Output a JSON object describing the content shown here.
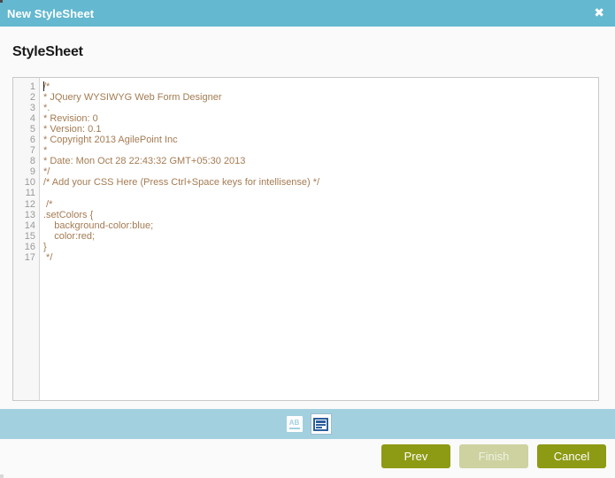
{
  "window": {
    "title": "New StyleSheet",
    "close_icon": "close-icon",
    "close_glyph": "✖"
  },
  "heading": {
    "text": "StyleSheet"
  },
  "editor": {
    "line_numbers": [
      "1",
      "2",
      "3",
      "4",
      "5",
      "6",
      "7",
      "8",
      "9",
      "10",
      "11",
      "12",
      "13",
      "14",
      "15",
      "16",
      "17"
    ],
    "lines": [
      "/*",
      "* JQuery WYSIWYG Web Form Designer",
      "*.",
      "* Revision: 0",
      "* Version: 0.1",
      "* Copyright 2013 AgilePoint Inc",
      "*",
      "* Date: Mon Oct 28 22:43:32 GMT+05:30 2013",
      "*/",
      "/* Add your CSS Here (Press Ctrl+Space keys for intellisense) */",
      "",
      " /*",
      ".setColors {",
      "    background-color:blue;",
      "    color:red;",
      "}",
      " */"
    ],
    "text_color": "#a47b52",
    "gutter_color": "#9a9a9a"
  },
  "toolbar": {
    "buttons": [
      {
        "name": "spellcheck-ab-icon",
        "label": "AB",
        "active": false
      },
      {
        "name": "form-view-icon",
        "label": "",
        "active": true
      }
    ],
    "background": "#a3d0de"
  },
  "footer": {
    "prev_label": "Prev",
    "finish_label": "Finish",
    "cancel_label": "Cancel",
    "accent_color": "#8d9a14",
    "disabled_color": "#cdd2a0"
  },
  "colors": {
    "titlebar": "#64b8cf",
    "page_background": "#fafafa"
  }
}
